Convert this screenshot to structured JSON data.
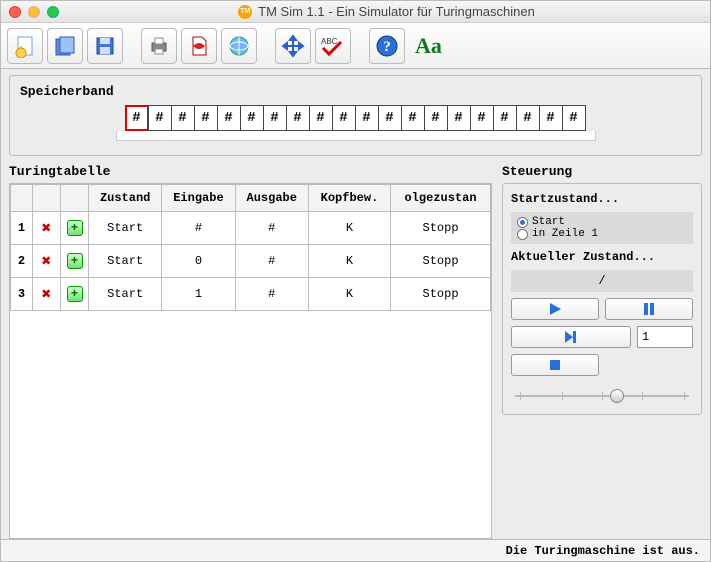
{
  "window": {
    "title": "TM Sim 1.1 - Ein Simulator für Turingmaschinen"
  },
  "toolbar": {
    "icons": [
      "new",
      "open",
      "save",
      "print",
      "pdf",
      "web",
      "move",
      "spellcheck",
      "help",
      "font"
    ]
  },
  "tape": {
    "label": "Speicherband",
    "cells": [
      "#",
      "#",
      "#",
      "#",
      "#",
      "#",
      "#",
      "#",
      "#",
      "#",
      "#",
      "#",
      "#",
      "#",
      "#",
      "#",
      "#",
      "#",
      "#",
      "#"
    ],
    "head_index": 0
  },
  "table": {
    "label": "Turingtabelle",
    "headers": [
      "",
      "",
      "",
      "Zustand",
      "Eingabe",
      "Ausgabe",
      "Kopfbew.",
      "olgezustan"
    ],
    "rows": [
      {
        "n": "1",
        "zustand": "Start",
        "eingabe": "#",
        "ausgabe": "#",
        "kopf": "K",
        "folge": "Stopp"
      },
      {
        "n": "2",
        "zustand": "Start",
        "eingabe": "0",
        "ausgabe": "#",
        "kopf": "K",
        "folge": "Stopp"
      },
      {
        "n": "3",
        "zustand": "Start",
        "eingabe": "1",
        "ausgabe": "#",
        "kopf": "K",
        "folge": "Stopp"
      }
    ]
  },
  "control": {
    "label": "Steuerung",
    "start_label": "Startzustand...",
    "radio1": "Start",
    "radio2": "in Zeile 1",
    "current_label": "Aktueller Zustand...",
    "current_value": "/",
    "step_value": "1"
  },
  "status": {
    "text": "Die Turingmaschine ist aus."
  }
}
